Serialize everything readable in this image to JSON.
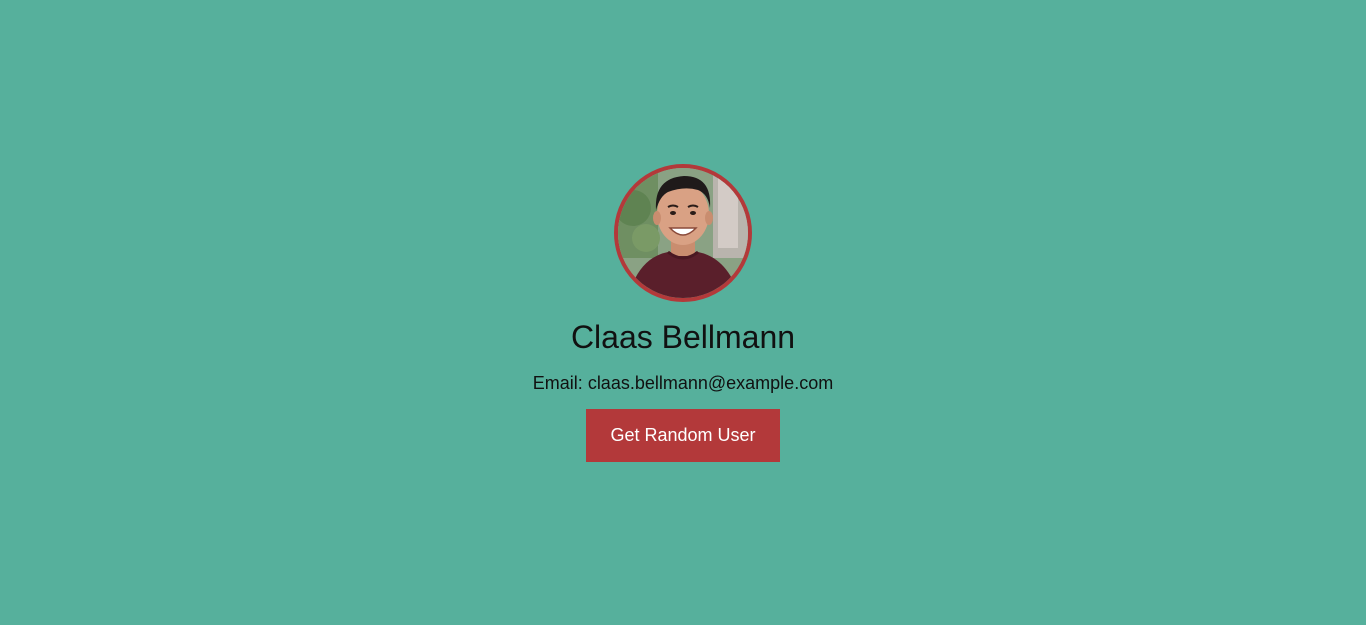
{
  "colors": {
    "background": "#56b09c",
    "accent": "#b3393a",
    "text": "#111111",
    "button_text": "#ffffff"
  },
  "user": {
    "name": "Claas Bellmann",
    "email_label": "Email:",
    "email": "claas.bellmann@example.com",
    "avatar_icon": "user-portrait-photo"
  },
  "actions": {
    "random_user_label": "Get Random User"
  }
}
